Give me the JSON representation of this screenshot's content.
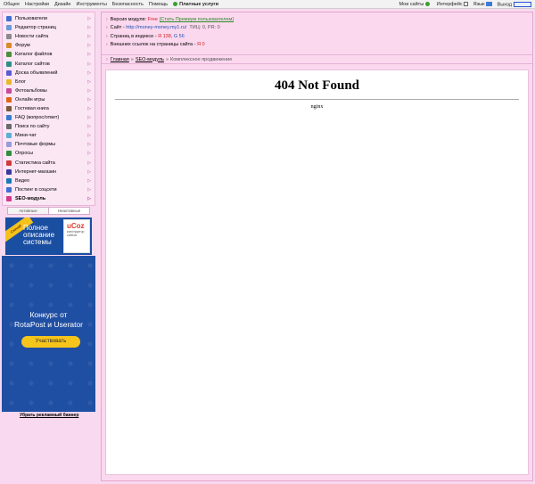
{
  "topbar": {
    "left": [
      "Общее",
      "Настройки",
      "Дизайн",
      "Инструменты",
      "Безопасность",
      "Помощь"
    ],
    "paid": "Платные услуги",
    "my_sites": "Мои сайты",
    "interface": "Интерфейс",
    "lang": "Язык",
    "exit": "Выход"
  },
  "sidebar": {
    "items": [
      {
        "label": "Пользователи",
        "color": "#3f6fd1"
      },
      {
        "label": "Редактор страниц",
        "color": "#6b9ad9"
      },
      {
        "label": "Новости сайта",
        "color": "#8a8a8a"
      },
      {
        "label": "Форум",
        "color": "#d98a2b"
      },
      {
        "label": "Каталог файлов",
        "color": "#4a8f3c"
      },
      {
        "label": "Каталог сайтов",
        "color": "#2f8f83"
      },
      {
        "label": "Доска объявлений",
        "color": "#5a5ad1"
      },
      {
        "label": "Блог",
        "color": "#e8b92b"
      },
      {
        "label": "Фотоальбомы",
        "color": "#c84a9a"
      },
      {
        "label": "Онлайн игры",
        "color": "#e0661a"
      },
      {
        "label": "Гостевая книга",
        "color": "#7b5a3a"
      },
      {
        "label": "FAQ (вопрос/ответ)",
        "color": "#3a7bd1"
      },
      {
        "label": "Поиск по сайту",
        "color": "#6a6a6a"
      },
      {
        "label": "Мини-чат",
        "color": "#5ab0d6"
      },
      {
        "label": "Почтовые формы",
        "color": "#9a9ad8"
      },
      {
        "label": "Опросы",
        "color": "#2f8f3c"
      },
      {
        "label": "Статистика сайта",
        "color": "#d13a3a"
      },
      {
        "label": "Интернет-магазин",
        "color": "#3a3a9a"
      },
      {
        "label": "Видео",
        "color": "#1a7ab5"
      },
      {
        "label": "Постинг в соцсети",
        "color": "#3f6fd1"
      },
      {
        "label": "SEO-модуль",
        "color": "#d13a8c"
      }
    ],
    "tabs": [
      "Активные",
      "Неактивные"
    ]
  },
  "ads": {
    "banner1_ribbon": "Скачай",
    "banner1_text": [
      "Полное",
      "описание",
      "системы"
    ],
    "banner1_logo": "uCoz",
    "banner1_logo_sub": "конструктор сайтов",
    "banner2_line1": "Конкурс от",
    "banner2_line2": "RotaPost и Userator",
    "banner2_button": "Участвовать",
    "remove_link": "Убрать рекламный баннер"
  },
  "info": {
    "version_label": "Версия модуля:",
    "version_value": "Free",
    "version_link": "[Стать Премиум пользователем]",
    "site_label": "Сайт -",
    "site_url": "http://money-money.my1.ru/",
    "tic_pr": "ТИЦ: 0, PR: 0",
    "pages_label": "Страниц в индексе -",
    "pages_y": "Я 138,",
    "pages_g": "G 56",
    "links_label": "Внешних ссылок на страницы сайта -",
    "links_y": "Я 0"
  },
  "breadcrumb": {
    "home": "Главная",
    "seo": "SEO-модуль",
    "current": "Комплексное продвижение",
    "sep": "»"
  },
  "content": {
    "heading": "404 Not Found",
    "server": "nginx"
  }
}
